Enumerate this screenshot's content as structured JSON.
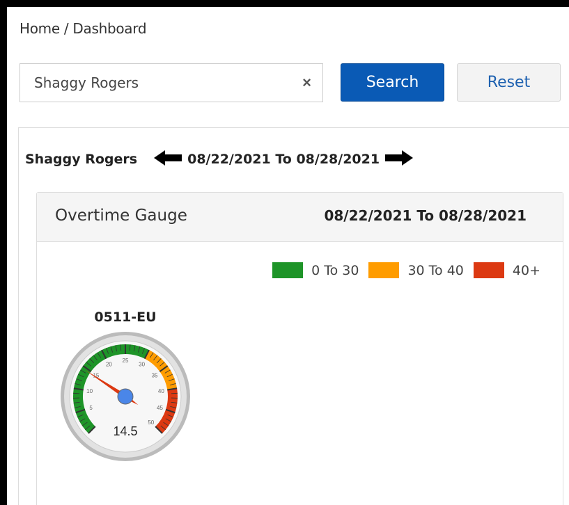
{
  "breadcrumb": "Home / Dashboard",
  "search": {
    "value": "Shaggy Rogers",
    "placeholder": "",
    "clear_icon": "×"
  },
  "buttons": {
    "search_label": "Search",
    "reset_label": "Reset"
  },
  "range": {
    "name": "Shaggy Rogers",
    "dates": "08/22/2021 To 08/28/2021"
  },
  "gauge_panel": {
    "title": "Overtime Gauge",
    "dates": "08/22/2021 To 08/28/2021",
    "legend": [
      {
        "label": "0 To 30",
        "color": "#1e9428"
      },
      {
        "label": "30 To 40",
        "color": "#ff9c00"
      },
      {
        "label": "40+",
        "color": "#dc3912"
      }
    ],
    "gauge": {
      "label": "0511-EU",
      "value": 14.5,
      "value_text": "14.5",
      "min": 0,
      "max": 50,
      "ticks": [
        "5",
        "10",
        "15",
        "20",
        "25",
        "30",
        "35",
        "40",
        "45",
        "50"
      ],
      "bands": [
        {
          "from": 0,
          "to": 30,
          "color": "#1e9428"
        },
        {
          "from": 30,
          "to": 40,
          "color": "#ff9c00"
        },
        {
          "from": 40,
          "to": 50,
          "color": "#dc3912"
        }
      ]
    }
  }
}
